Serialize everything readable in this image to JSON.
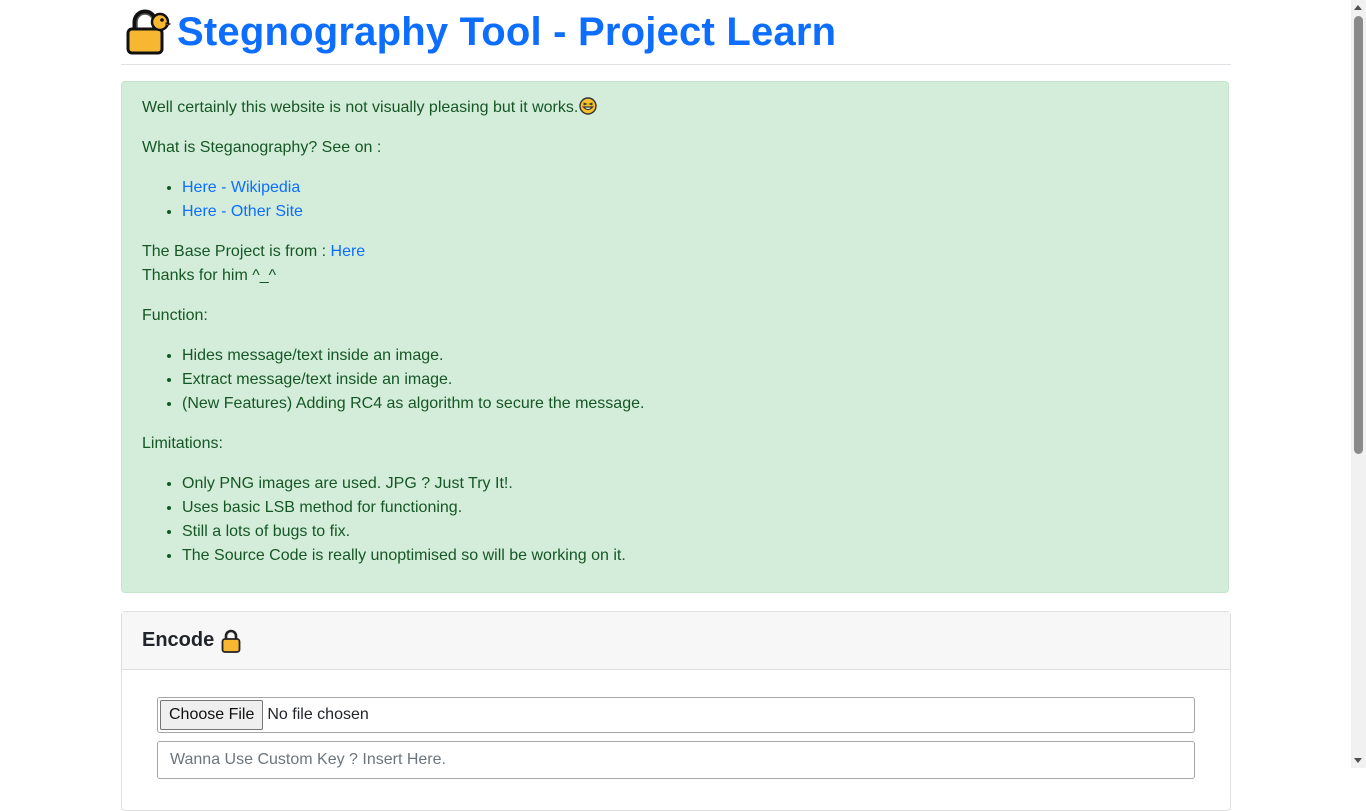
{
  "header": {
    "title": "Stegnography Tool - Project Learn",
    "logo_icon": "lock-with-duck-icon"
  },
  "alert": {
    "intro": "Well certainly this website is not visually pleasing but it works.",
    "intro_emoji": "grinning-squinting-face-icon",
    "what_is": "What is Steganography? See on :",
    "links": [
      {
        "label": "Here - Wikipedia"
      },
      {
        "label": "Here - Other Site"
      }
    ],
    "base_project_prefix": "The Base Project is from : ",
    "base_project_link": "Here",
    "thanks": "Thanks for him ^_^",
    "function_heading": "Function:",
    "functions": [
      "Hides message/text inside an image.",
      "Extract message/text inside an image.",
      "(New Features) Adding RC4 as algorithm to secure the message."
    ],
    "limitations_heading": "Limitations:",
    "limitations": [
      "Only PNG images are used. JPG ? Just Try It!.",
      "Uses basic LSB method for functioning.",
      "Still a lots of bugs to fix.",
      "The Source Code is really unoptimised so will be working on it."
    ]
  },
  "encode": {
    "heading": "Encode",
    "heading_icon": "lock-icon",
    "file_button": "Choose File",
    "file_status": "No file chosen",
    "key_placeholder": "Wanna Use Custom Key ? Insert Here."
  },
  "colors": {
    "title_blue": "#0d6efd",
    "alert_bg": "#d4edda",
    "alert_text": "#155724",
    "link": "#0d6efd"
  }
}
